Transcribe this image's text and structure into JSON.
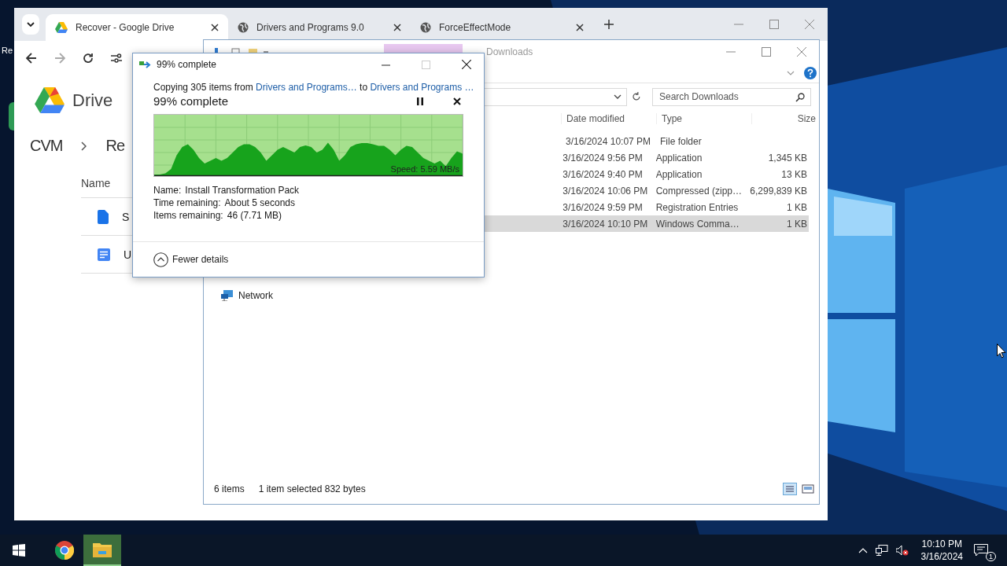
{
  "desktop": {
    "icon_label": "Re"
  },
  "browser": {
    "tabs": [
      {
        "title": "Recover - Google Drive",
        "kind": "drive",
        "selected": true
      },
      {
        "title": "Drivers and Programs 9.0",
        "kind": "globe",
        "selected": false
      },
      {
        "title": "ForceEffectMode",
        "kind": "globe",
        "selected": false
      }
    ],
    "drive": {
      "product": "Drive",
      "breadcrumb": [
        "CVM",
        "Re"
      ],
      "column": "Name",
      "files": [
        {
          "name": "S",
          "kind": "file"
        },
        {
          "name": "U",
          "kind": "doc"
        }
      ]
    }
  },
  "explorer": {
    "title": "Downloads",
    "search": {
      "placeholder": "Search Downloads"
    },
    "columns": [
      "Date modified",
      "Type",
      "Size"
    ],
    "rows": [
      {
        "date": "3/16/2024 10:07 PM",
        "type": "File folder",
        "size": "",
        "selected": false
      },
      {
        "date": "3/16/2024 9:56 PM",
        "type": "Application",
        "size": "1,345 KB",
        "selected": false
      },
      {
        "date": "3/16/2024 9:40 PM",
        "type": "Application",
        "size": "13 KB",
        "selected": false
      },
      {
        "date": "3/16/2024 10:06 PM",
        "type": "Compressed (zipp…",
        "size": "6,299,839 KB",
        "selected": false
      },
      {
        "date": "3/16/2024 9:59 PM",
        "type": "Registration Entries",
        "size": "1 KB",
        "selected": false
      },
      {
        "date": "3/16/2024 10:10 PM",
        "type": "Windows Comma…",
        "size": "1 KB",
        "selected": true
      }
    ],
    "nav": [
      {
        "label": "Network"
      }
    ],
    "status": {
      "count": "6 items",
      "selection": "1 item selected  832 bytes"
    }
  },
  "dialog": {
    "title": "99% complete",
    "prefix": "Copying 305 items from",
    "source": "Drivers and Programs…",
    "middle": "to",
    "destination": "Drivers and Programs …",
    "heading": "99% complete",
    "speed": "Speed: 5.59 MB/s",
    "details": [
      {
        "label": "Name:",
        "value": "Install Transformation Pack"
      },
      {
        "label": "Time remaining:",
        "value": "About 5 seconds"
      },
      {
        "label": "Items remaining:",
        "value": "46 (7.71 MB)"
      }
    ],
    "toggle": "Fewer details"
  },
  "taskbar": {
    "apps": [
      {
        "kind": "chrome",
        "active": false
      },
      {
        "kind": "explorer",
        "active": true
      }
    ],
    "time": "10:10 PM",
    "date": "3/16/2024",
    "notifications": "1"
  }
}
